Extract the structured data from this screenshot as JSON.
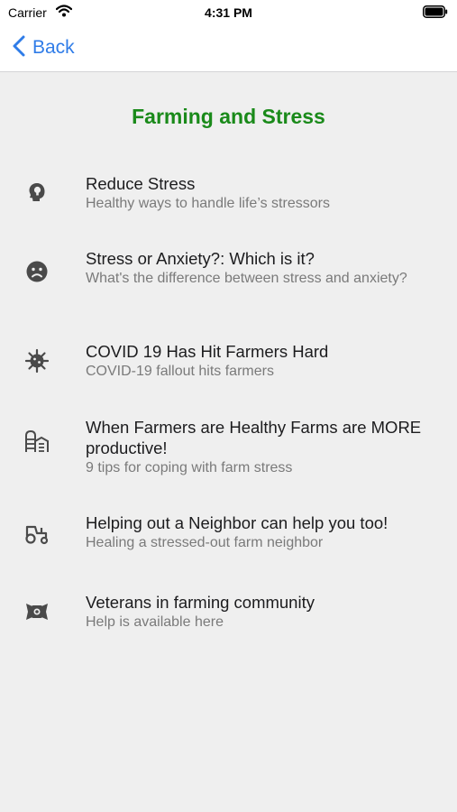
{
  "status_bar": {
    "carrier": "Carrier",
    "time": "4:31 PM"
  },
  "nav": {
    "back_label": "Back",
    "accent_color": "#2f7ce8"
  },
  "page": {
    "title": "Farming and Stress",
    "title_color": "#1a8a1a"
  },
  "items": [
    {
      "title": "Reduce Stress",
      "subtitle": "Healthy ways to handle life’s stressors",
      "icon": "lightbulb-head-icon"
    },
    {
      "title": "Stress or Anxiety?: Which is it?",
      "subtitle": "What's the difference between stress and anxiety?",
      "icon": "frown-face-icon"
    },
    {
      "title": "COVID 19 Has Hit Farmers Hard",
      "subtitle": "COVID-19 fallout hits farmers",
      "icon": "virus-icon"
    },
    {
      "title": "When Farmers are Healthy Farms are MORE productive!",
      "subtitle": "9 tips for coping with farm stress",
      "icon": "barn-silo-icon"
    },
    {
      "title": "Helping out a Neighbor can help you too!",
      "subtitle": "Healing a stressed-out farm neighbor",
      "icon": "tractor-icon"
    },
    {
      "title": "Veterans in farming community",
      "subtitle": "Help is available here",
      "icon": "veteran-emblem-icon"
    }
  ]
}
